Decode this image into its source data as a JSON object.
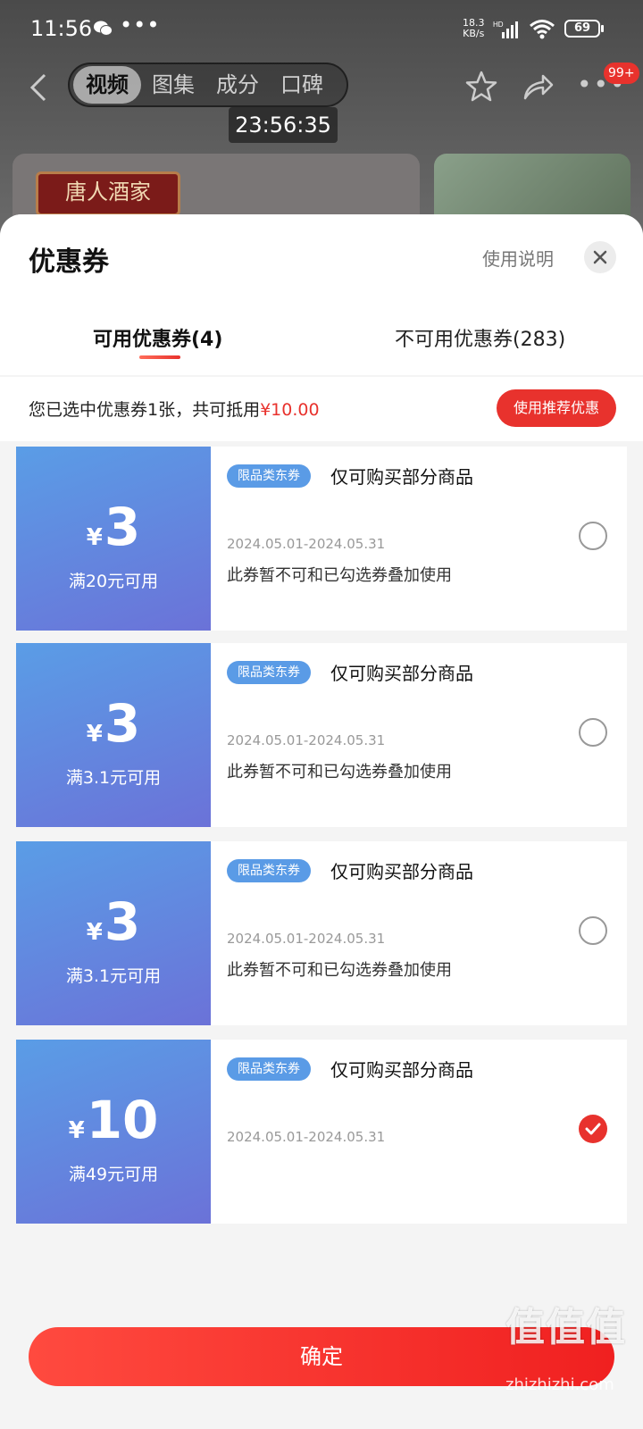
{
  "status_bar": {
    "time": "11:56",
    "dots": "•••",
    "net_speed_top": "18.3",
    "net_speed_bottom": "KB/s",
    "net_type": "HD",
    "battery": "69"
  },
  "top_nav": {
    "tabs": [
      {
        "label": "视频"
      },
      {
        "label": "图集"
      },
      {
        "label": "成分"
      },
      {
        "label": "口碑"
      }
    ],
    "timer": "23:56:35",
    "more_label": "•••",
    "badge": "99+",
    "brand_logo_text": "唐人酒家"
  },
  "sheet": {
    "title": "优惠券",
    "usage_link": "使用说明",
    "tabs": {
      "available": "可用优惠券(4)",
      "unavailable": "不可用优惠券(283)"
    },
    "summary_prefix": "您已选中优惠券1张，共可抵用",
    "summary_amount": "¥10.00",
    "recommend_button": "使用推荐优惠"
  },
  "coupons": [
    {
      "currency": "¥",
      "amount": "3",
      "condition": "满20元可用",
      "tag": "限品类东券",
      "title": "仅可购买部分商品",
      "date": "2024.05.01-2024.05.31",
      "note": "此券暂不可和已勾选券叠加使用",
      "selected": false
    },
    {
      "currency": "¥",
      "amount": "3",
      "condition": "满3.1元可用",
      "tag": "限品类东券",
      "title": "仅可购买部分商品",
      "date": "2024.05.01-2024.05.31",
      "note": "此券暂不可和已勾选券叠加使用",
      "selected": false
    },
    {
      "currency": "¥",
      "amount": "3",
      "condition": "满3.1元可用",
      "tag": "限品类东券",
      "title": "仅可购买部分商品",
      "date": "2024.05.01-2024.05.31",
      "note": "此券暂不可和已勾选券叠加使用",
      "selected": false
    },
    {
      "currency": "¥",
      "amount": "10",
      "condition": "满49元可用",
      "tag": "限品类东券",
      "title": "仅可购买部分商品",
      "date": "2024.05.01-2024.05.31",
      "note": "",
      "selected": true
    }
  ],
  "confirm_button": "确定",
  "watermark": {
    "text": "值值值",
    "url": "zhizhizhi.com"
  },
  "colors": {
    "accent": "#e8322d",
    "coupon_blue": "#5a9de6",
    "coupon_purple": "#6b72d8"
  }
}
